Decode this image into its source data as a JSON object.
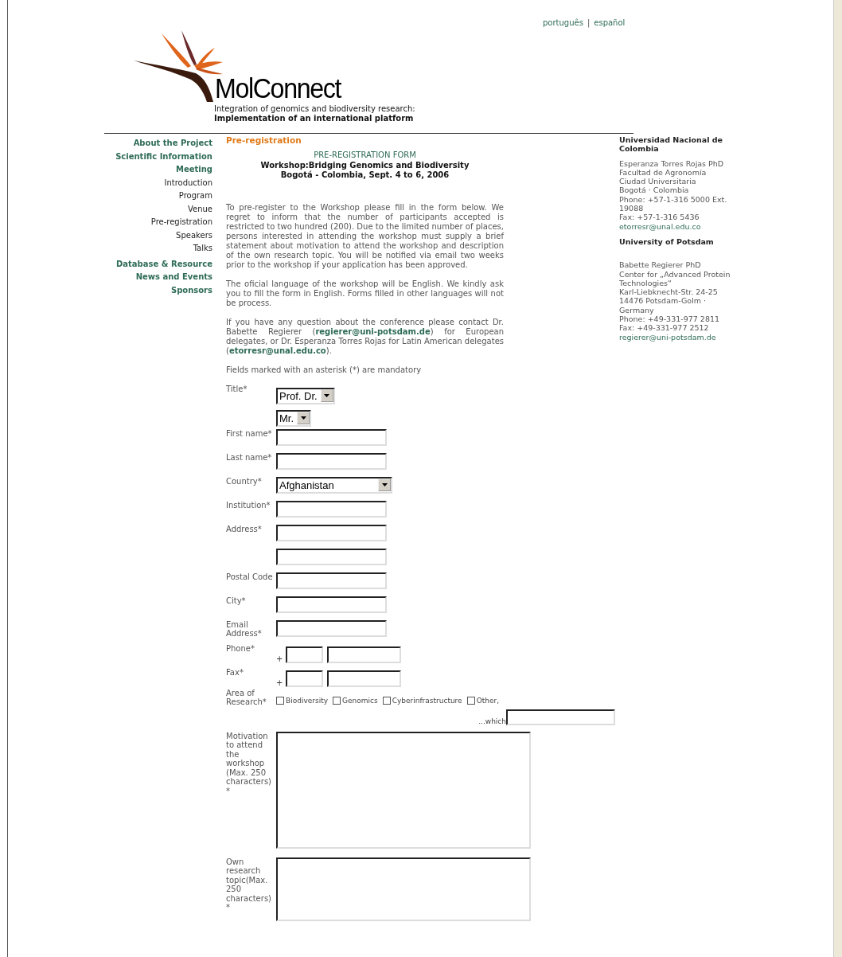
{
  "language_links": [
    {
      "label": "português"
    },
    {
      "label": "español"
    }
  ],
  "language_separator": "|",
  "logo": {
    "name": "MolConnect",
    "tagline": "Integration of genomics and biodiversity research:",
    "subtitle": "Implementation of an international platform"
  },
  "nav": [
    {
      "label": "About the Project",
      "kind": "section"
    },
    {
      "label": "Scientific Information",
      "kind": "section"
    },
    {
      "label": "Meeting",
      "kind": "section"
    },
    {
      "label": "Introduction",
      "kind": "subitem"
    },
    {
      "label": "Program",
      "kind": "subitem"
    },
    {
      "label": "Venue",
      "kind": "subitem"
    },
    {
      "label": "Pre-registration",
      "kind": "subitem"
    },
    {
      "label": "Speakers",
      "kind": "subitem"
    },
    {
      "label": "Talks",
      "kind": "subitem"
    },
    {
      "label": "Database & Resource",
      "kind": "section"
    },
    {
      "label": "News and Events",
      "kind": "section"
    },
    {
      "label": "Sponsors",
      "kind": "section"
    }
  ],
  "main": {
    "breadcrumb": "Pre-registration",
    "form_heading": "PRE-REGISTRATION FORM",
    "workshop_title": "Workshop:Bridging Genomics and Biodiversity",
    "workshop_place": "Bogotá - Colombia, Sept. 4 to 6, 2006",
    "paragraphs": [
      "To pre-register to the Workshop please fill in the form below. We regret to inform that the number of participants accepted is restricted to two hundred (200). Due to the limited number of places, persons interested in attending the workshop must supply a brief statement about motivation to attend the workshop and description of the own research topic. You will be notified via email two weeks prior to the workshop if your application has been approved.",
      "The oficial language of the workshop will be English. We kindly ask you to fill the form in English. Forms filled in other languages will not be process.",
      "If you have any question about the conference please contact Dr. Babette Regierer (**regierer@uni-potsdam.de**) for European delegates, or Dr. Esperanza Torres Rojas for Latin American delegates (**etorresr@unal.edu.co**).",
      "Fields marked with an asterisk (*) are mandatory"
    ]
  },
  "form": {
    "fields": [
      {
        "kind": "select",
        "label": "Title*",
        "value": "Prof. Dr."
      },
      {
        "kind": "select",
        "value": "Mr."
      },
      {
        "kind": "text",
        "label": "First name*"
      },
      {
        "kind": "text",
        "label": "Last name*"
      },
      {
        "kind": "select",
        "label": "Country*",
        "value": "Afghanistan"
      },
      {
        "kind": "text",
        "label": "Institution*"
      },
      {
        "kind": "text",
        "label": "Address*"
      },
      {
        "kind": "text"
      },
      {
        "kind": "text",
        "label": "Postal Code"
      },
      {
        "kind": "text",
        "label": "City*"
      },
      {
        "kind": "text",
        "label": "Email Address*"
      },
      {
        "kind": "phone",
        "label": "Phone*",
        "prefix": "+"
      },
      {
        "kind": "phone",
        "label": "Fax*",
        "prefix": "+"
      },
      {
        "kind": "checkboxes",
        "label": "Area of Research*",
        "options": [
          {
            "label": "Biodiversity",
            "checked": false
          },
          {
            "label": "Genomics",
            "checked": false
          },
          {
            "label": "Cyberinfrastructure",
            "checked": false
          },
          {
            "label": "Other,",
            "checked": false
          }
        ],
        "other_label": "...which"
      },
      {
        "kind": "textarea",
        "label": "Motivation to attend the workshop (Max. 250 characters) *"
      },
      {
        "kind": "textarea",
        "label": "Own research topic(Max. 250 characters) *"
      }
    ]
  },
  "contacts": [
    {
      "institution": "Universidad Nacional de Colombia",
      "lines": [
        "Esperanza Torres Rojas PhD",
        "Facultad de Agronomía",
        "Ciudad Universitaria",
        "Bogotá · Colombia",
        "Phone: +57-1-316 5000 Ext. 19088",
        "Fax: +57-1-316 5436"
      ],
      "email": "etorresr@unal.edu.co"
    },
    {
      "institution": "University of Potsdam",
      "lines": [
        "Babette Regierer PhD",
        "Center for „Advanced Protein Technologies“",
        "Karl-Liebknecht-Str. 24-25",
        "14476 Potsdam-Golm · Germany",
        "Phone: +49-331-977 2811",
        "Fax: +49-331-977 2512"
      ],
      "email": "regierer@uni-potsdam.de"
    }
  ]
}
